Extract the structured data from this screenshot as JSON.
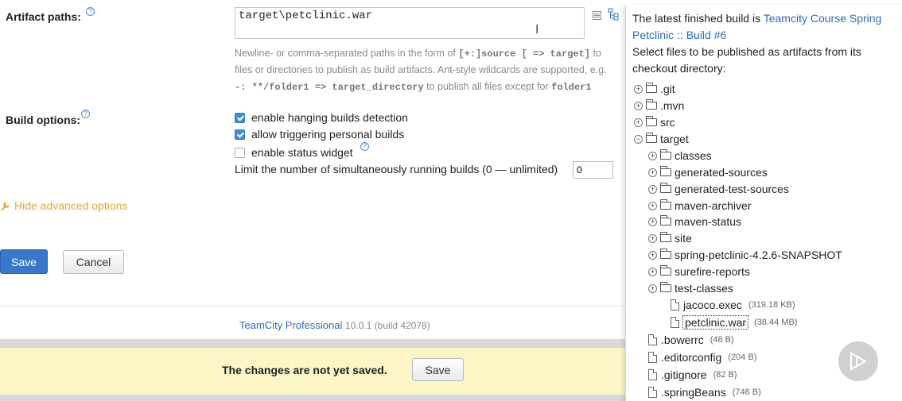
{
  "artifact": {
    "label": "Artifact paths:",
    "value": "target\\petclinic.war",
    "hint_line1_pre": "Newline- or comma-separated paths in the form of ",
    "hint_line1_code": "[+:]source [ => target]",
    "hint_line1_post": " to",
    "hint_line2": "files or directories to publish as build artifacts. Ant-style wildcards are supported, e.g.",
    "hint_line3_code1": "-: **/folder1 => target_directory",
    "hint_line3_mid": " to publish all files except for ",
    "hint_line3_code2": "folder1"
  },
  "build_options": {
    "label": "Build options:",
    "options": [
      {
        "label": "enable hanging builds detection",
        "checked": true
      },
      {
        "label": "allow triggering personal builds",
        "checked": true
      },
      {
        "label": "enable status widget",
        "checked": false
      }
    ],
    "limit_label": "Limit the number of simultaneously running builds (0 — unlimited)",
    "limit_value": "0"
  },
  "advanced": {
    "hide_label": "Hide advanced options"
  },
  "buttons": {
    "save": "Save",
    "cancel": "Cancel"
  },
  "footer": {
    "product": "TeamCity Professional",
    "version": "10.0.1 (build 42078)"
  },
  "unsaved_bar": {
    "message": "The changes are not yet saved.",
    "save": "Save"
  },
  "popup": {
    "intro_pre": "The latest finished build is ",
    "build_link": "Teamcity Course Spring Petclinic :: Build #6",
    "description": "Select files to be published as artifacts from its checkout directory:",
    "tree": [
      {
        "name": ".git",
        "type": "folder",
        "toggle": "+"
      },
      {
        "name": ".mvn",
        "type": "folder",
        "toggle": "+"
      },
      {
        "name": "src",
        "type": "folder",
        "toggle": "+"
      },
      {
        "name": "target",
        "type": "folder",
        "toggle": "−"
      },
      {
        "name": "classes",
        "type": "folder",
        "toggle": "+"
      },
      {
        "name": "generated-sources",
        "type": "folder",
        "toggle": "+"
      },
      {
        "name": "generated-test-sources",
        "type": "folder",
        "toggle": "+"
      },
      {
        "name": "maven-archiver",
        "type": "folder",
        "toggle": "+"
      },
      {
        "name": "maven-status",
        "type": "folder",
        "toggle": "+"
      },
      {
        "name": "site",
        "type": "folder",
        "toggle": "+"
      },
      {
        "name": "spring-petclinic-4.2.6-SNAPSHOT",
        "type": "folder",
        "toggle": "+"
      },
      {
        "name": "surefire-reports",
        "type": "folder",
        "toggle": "+"
      },
      {
        "name": "test-classes",
        "type": "folder",
        "toggle": "+"
      },
      {
        "name": "jacoco.exec",
        "type": "file",
        "size": "(319.18 KB)"
      },
      {
        "name": "petclinic.war",
        "type": "file",
        "size": "(38.44 MB)"
      },
      {
        "name": ".bowerrc",
        "type": "file",
        "size": "(48 B)"
      },
      {
        "name": ".editorconfig",
        "type": "file",
        "size": "(204 B)"
      },
      {
        "name": ".gitignore",
        "type": "file",
        "size": "(82 B)"
      },
      {
        "name": ".springBeans",
        "type": "file",
        "size": "(746 B)"
      }
    ]
  }
}
